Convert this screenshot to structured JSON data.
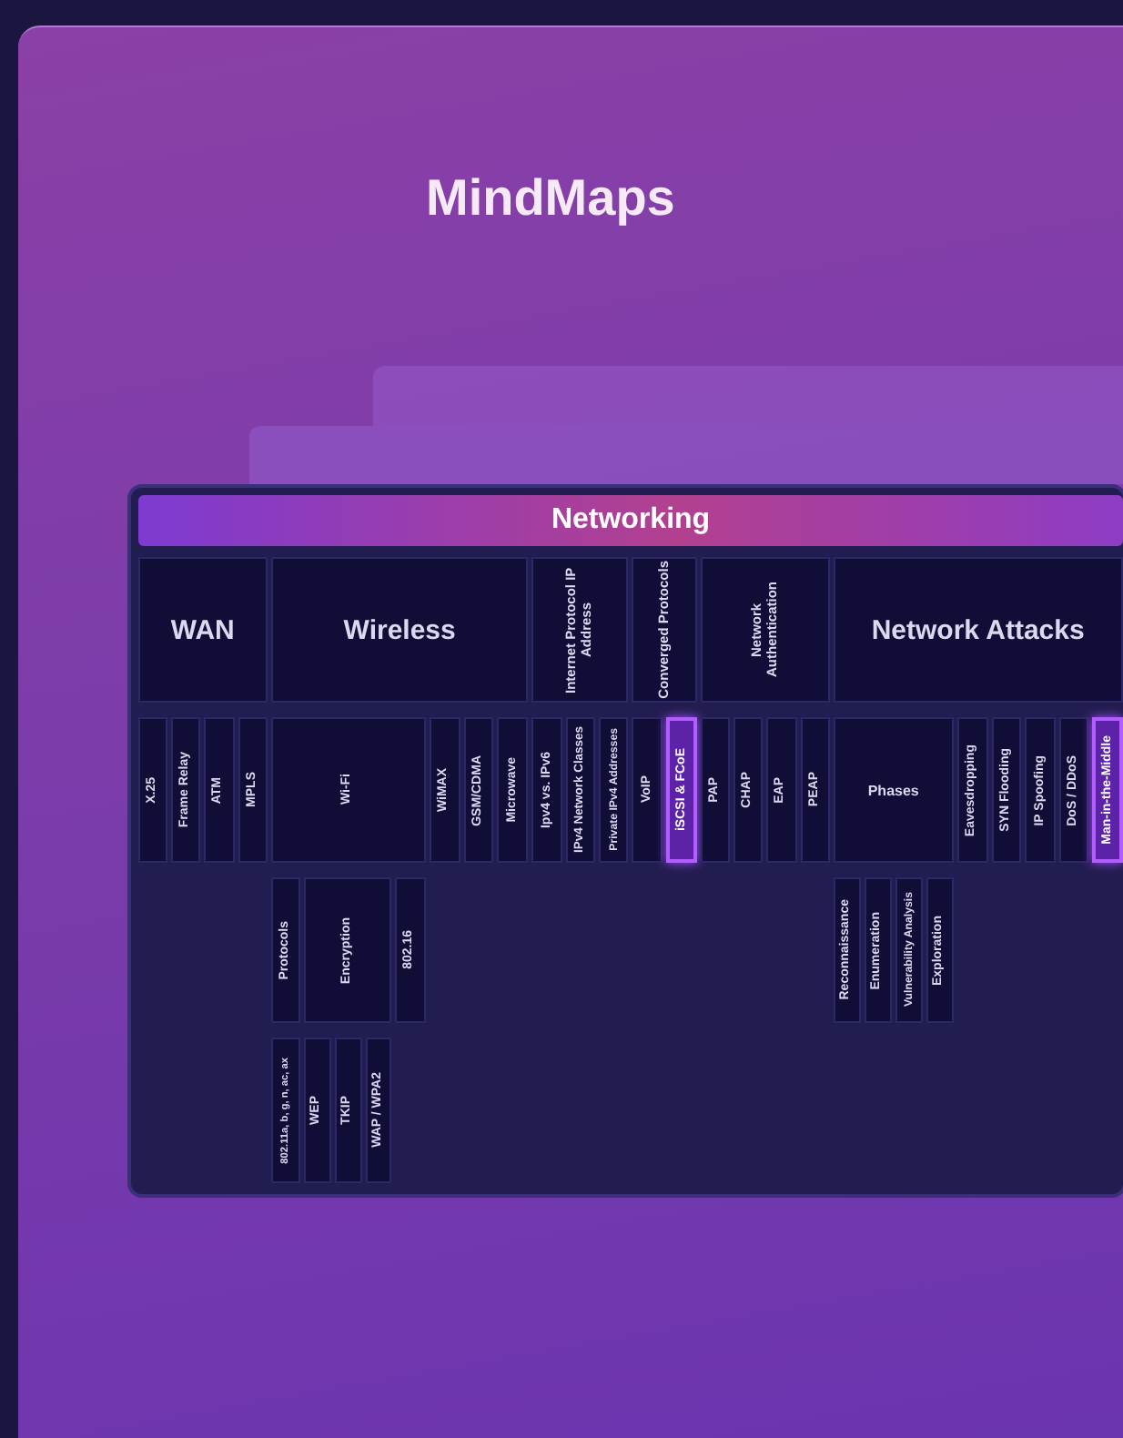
{
  "page": {
    "title": "MindMaps"
  },
  "mindmap": {
    "root": {
      "label": "Networking",
      "selected": false,
      "children": [
        {
          "label": "WAN",
          "kind": "horizontal",
          "selected": false,
          "children": [
            {
              "label": "X.25",
              "kind": "vertical",
              "selected": false
            },
            {
              "label": "Frame Relay",
              "kind": "vertical",
              "selected": false
            },
            {
              "label": "ATM",
              "kind": "vertical",
              "selected": false
            },
            {
              "label": "MPLS",
              "kind": "vertical",
              "selected": false
            }
          ]
        },
        {
          "label": "Wireless",
          "kind": "horizontal",
          "selected": false,
          "children": [
            {
              "label": "Wi-Fi",
              "kind": "vertical",
              "selected": false,
              "children": [
                {
                  "label": "Protocols",
                  "kind": "vertical",
                  "selected": false,
                  "children": [
                    {
                      "label": "802.11a, b, g, n, ac, ax",
                      "kind": "vertical",
                      "selected": false
                    }
                  ]
                },
                {
                  "label": "Encryption",
                  "kind": "vertical",
                  "selected": false,
                  "children": [
                    {
                      "label": "WEP",
                      "kind": "vertical",
                      "selected": false
                    },
                    {
                      "label": "TKIP",
                      "kind": "vertical",
                      "selected": false
                    },
                    {
                      "label": "WAP / WPA2",
                      "kind": "vertical",
                      "selected": false
                    }
                  ]
                },
                {
                  "label": "802.16",
                  "kind": "vertical",
                  "selected": false
                }
              ]
            },
            {
              "label": "WiMAX",
              "kind": "vertical",
              "selected": false
            },
            {
              "label": "GSM/CDMA",
              "kind": "vertical",
              "selected": false
            },
            {
              "label": "Microwave",
              "kind": "vertical",
              "selected": false
            }
          ]
        },
        {
          "label": "Internet Protocol IP Address",
          "kind": "vertical",
          "selected": false,
          "children": [
            {
              "label": "Ipv4 vs. IPv6",
              "kind": "vertical",
              "selected": false
            },
            {
              "label": "IPv4 Network Classes",
              "kind": "vertical",
              "selected": false
            },
            {
              "label": "Private IPv4 Addresses",
              "kind": "vertical",
              "selected": false
            }
          ]
        },
        {
          "label": "Converged Protocols",
          "kind": "vertical",
          "selected": false,
          "children": [
            {
              "label": "VoIP",
              "kind": "vertical",
              "selected": false
            },
            {
              "label": "iSCSI & FCoE",
              "kind": "vertical",
              "selected": true
            }
          ]
        },
        {
          "label": "Network Authentication",
          "kind": "vertical",
          "selected": false,
          "children": [
            {
              "label": "PAP",
              "kind": "vertical",
              "selected": false
            },
            {
              "label": "CHAP",
              "kind": "vertical",
              "selected": false
            },
            {
              "label": "EAP",
              "kind": "vertical",
              "selected": false
            },
            {
              "label": "PEAP",
              "kind": "vertical",
              "selected": false
            }
          ]
        },
        {
          "label": "Network Attacks",
          "kind": "horizontal",
          "selected": false,
          "children": [
            {
              "label": "Phases",
              "kind": "horizontal",
              "selected": false,
              "children": [
                {
                  "label": "Reconnaissance",
                  "kind": "vertical",
                  "selected": false
                },
                {
                  "label": "Enumeration",
                  "kind": "vertical",
                  "selected": false
                },
                {
                  "label": "Vulnerability Analysis",
                  "kind": "vertical",
                  "selected": false
                },
                {
                  "label": "Exploration",
                  "kind": "vertical",
                  "selected": false
                }
              ]
            },
            {
              "label": "Eavesdropping",
              "kind": "vertical",
              "selected": false
            },
            {
              "label": "SYN Flooding",
              "kind": "vertical",
              "selected": false
            },
            {
              "label": "IP Spoofing",
              "kind": "vertical",
              "selected": false
            },
            {
              "label": "DoS / DDoS",
              "kind": "vertical",
              "selected": false
            },
            {
              "label": "Man-in-the-Middle",
              "kind": "vertical",
              "selected": true
            }
          ]
        }
      ]
    }
  }
}
